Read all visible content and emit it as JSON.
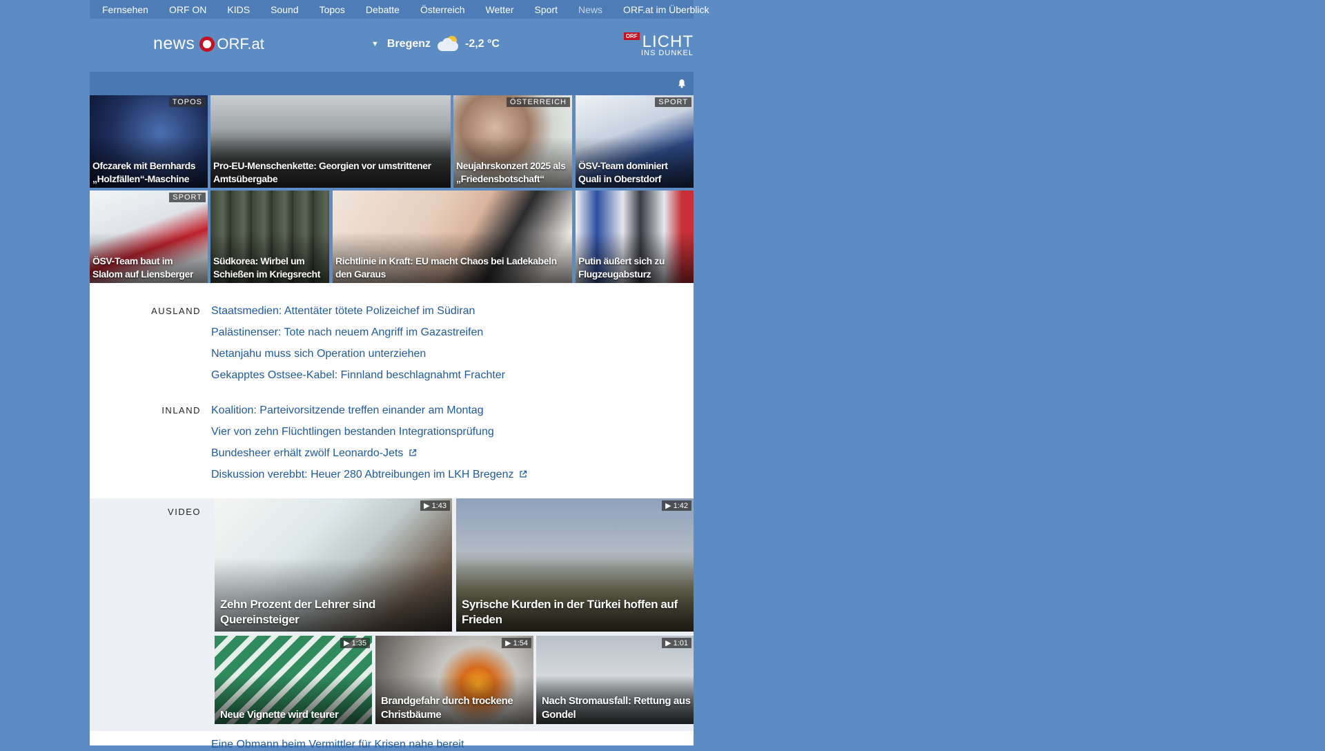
{
  "nav": {
    "items": [
      "Fernsehen",
      "ORF ON",
      "KIDS",
      "Sound",
      "Topos",
      "Debatte",
      "Österreich",
      "Wetter",
      "Sport",
      "News"
    ],
    "active": "News",
    "overview": "ORF.at im Überblick"
  },
  "brand": {
    "news": "news",
    "orf": "ORF.at"
  },
  "weather": {
    "location": "Bregenz",
    "temperature": "-2,2 °C",
    "icon": "partly-cloudy-icon"
  },
  "licht": {
    "badge": "ORF",
    "title": "LICHT",
    "subtitle": "INS DUNKEL"
  },
  "tiles_row1": [
    {
      "tag": "TOPOS",
      "title": "Ofczarek mit Bernhards „Holzfällen“-Maschine"
    },
    {
      "tag": "",
      "title": "Pro-EU-Menschenkette: Georgien vor umstrittener Amtsübergabe"
    },
    {
      "tag": "ÖSTERREICH",
      "title": "Neujahrskonzert 2025 als „Friedensbotschaft“"
    },
    {
      "tag": "SPORT",
      "title": "ÖSV-Team dominiert Quali in Oberstdorf"
    }
  ],
  "tiles_row2": [
    {
      "tag": "SPORT",
      "title": "ÖSV-Team baut im Slalom auf Liensberger"
    },
    {
      "tag": "",
      "title": "Südkorea: Wirbel um Schießen im Kriegsrecht"
    },
    {
      "tag": "",
      "title": "Richtlinie in Kraft: EU macht Chaos bei Ladekabeln den Garaus"
    },
    {
      "tag": "",
      "title": "Putin äußert sich zu Flugzeugabsturz"
    }
  ],
  "ausland": {
    "label": "AUSLAND",
    "links": [
      "Staatsmedien: Attentäter tötete Polizeichef im Südiran",
      "Palästinenser: Tote nach neuem Angriff im Gazastreifen",
      "Netanjahu muss sich Operation unterziehen",
      "Gekapptes Ostsee-Kabel: Finnland beschlagnahmt Frachter"
    ]
  },
  "inland": {
    "label": "INLAND",
    "links": [
      "Koalition: Parteivorsitzende treffen einander am Montag",
      "Vier von zehn Flüchtlingen bestanden Integrationsprüfung",
      "Bundesheer erhält zwölf Leonardo-Jets",
      "Diskussion verebbt: Heuer 280 Abtreibungen im LKH Bregenz"
    ]
  },
  "video": {
    "label": "VIDEO",
    "large": [
      {
        "duration": "1:43",
        "title": "Zehn Prozent der Lehrer sind Quereinsteiger"
      },
      {
        "duration": "1:42",
        "title": "Syrische Kurden in der Türkei hoffen auf Frieden"
      }
    ],
    "small": [
      {
        "duration": "1:35",
        "title": "Neue Vignette wird teurer"
      },
      {
        "duration": "1:54",
        "title": "Brandgefahr durch trockene Christbäume"
      },
      {
        "duration": "1:01",
        "title": "Nach Stromausfall: Rettung aus Gondel"
      }
    ]
  },
  "bottom_link": "Eine Obmann beim Vermittler für Krisen nahe bereit",
  "colors": {
    "page_bg": "#5d8cc4",
    "link": "#1f5a9e",
    "orf_red": "#c5101f"
  }
}
